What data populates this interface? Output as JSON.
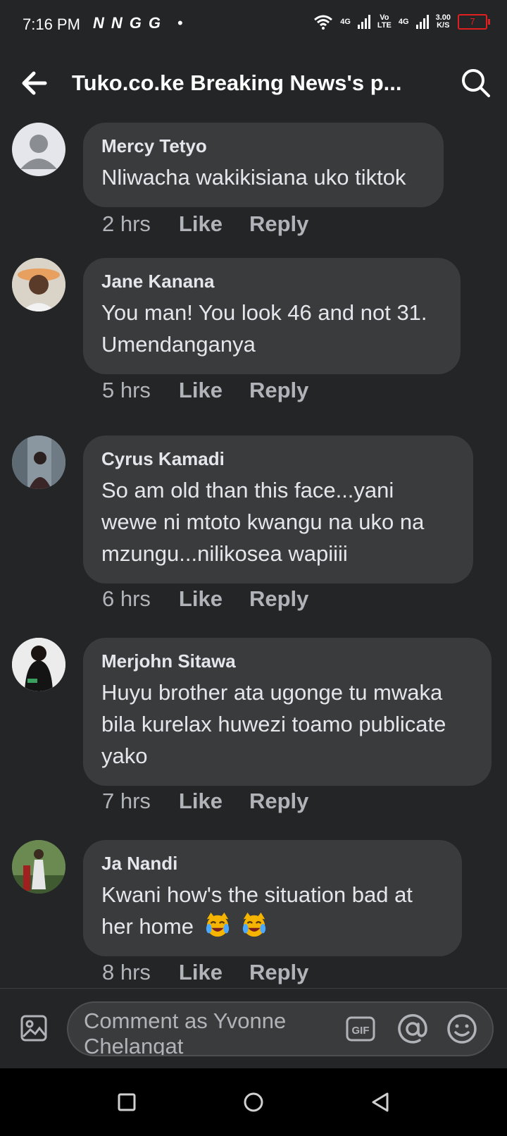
{
  "status_bar": {
    "time": "7:16 PM",
    "left_glyphs": [
      "N",
      "N",
      "G",
      "G"
    ],
    "dot": "•",
    "net1": "4G",
    "volte_top": "Vo",
    "volte_bottom": "LTE",
    "net2": "4G",
    "speed_value": "3.00",
    "speed_unit": "K/S",
    "battery": "7"
  },
  "header": {
    "title": "Tuko.co.ke Breaking News's p..."
  },
  "comments": [
    {
      "name": "Mercy Tetyo",
      "text": "Nliwacha wakikisiana uko tiktok",
      "time": "2 hrs",
      "like": "Like",
      "reply": "Reply"
    },
    {
      "name": "Jane Kanana",
      "text": "You man! You look 46 and not 31. Umendanganya",
      "time": "5 hrs",
      "like": "Like",
      "reply": "Reply"
    },
    {
      "name": "Cyrus Kamadi",
      "text": "So am old than this face...yani wewe ni mtoto kwangu na uko na mzungu...nilikosea wapiiii",
      "time": "6 hrs",
      "like": "Like",
      "reply": "Reply"
    },
    {
      "name": "Merjohn Sitawa",
      "text": "Huyu brother ata ugonge tu mwaka bila kurelax huwezi toamo publicate yako",
      "time": "7 hrs",
      "like": "Like",
      "reply": "Reply"
    },
    {
      "name": "Ja Nandi",
      "text": "Kwani how's the situation bad at her home",
      "time": "8 hrs",
      "like": "Like",
      "reply": "Reply"
    }
  ],
  "composer": {
    "placeholder": "Comment as Yvonne Chelangat",
    "gif_label": "GIF"
  },
  "colors": {
    "background": "#242526",
    "bubble": "#3a3b3c",
    "text": "#e4e6eb",
    "secondary_text": "#b0b3b8",
    "battery_low": "#e02020"
  }
}
